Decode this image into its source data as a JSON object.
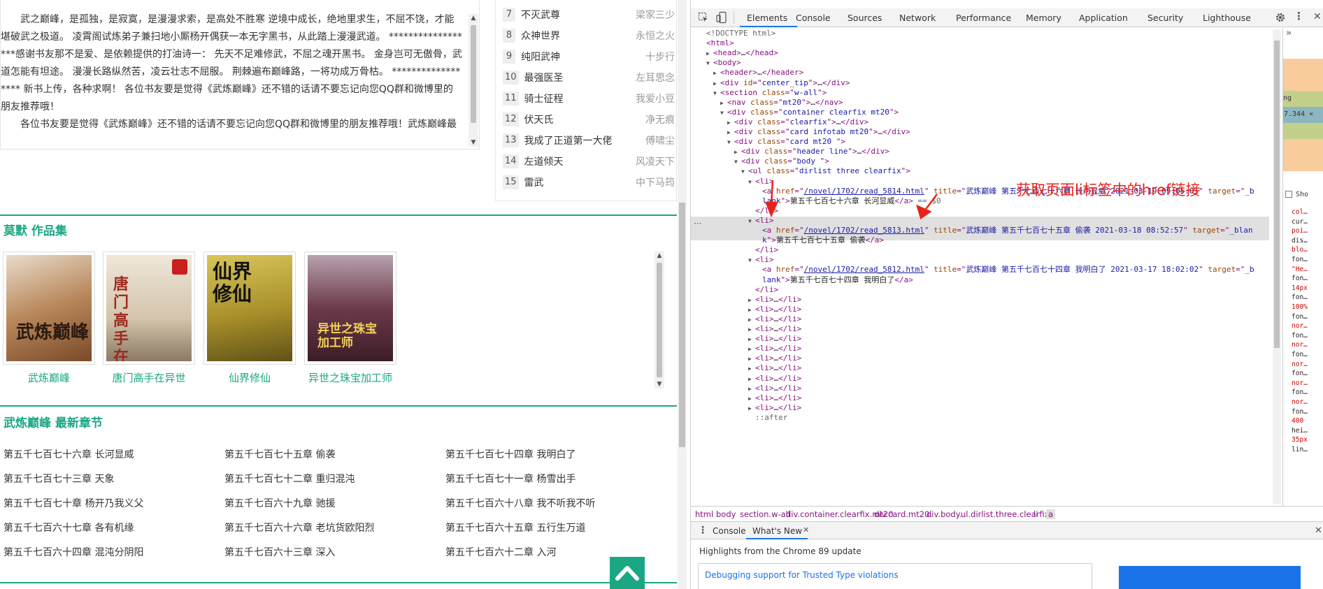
{
  "intro": {
    "paragraphs": [
      "武之巅峰，是孤独，是寂寞，是漫漫求索，是高处不胜寒 逆境中成长，绝地里求生，不屈不饶，才能堪破武之极道。 凌霄阁试炼弟子兼扫地小厮杨开偶获一本无字黑书，从此踏上漫漫武道。 ******************感谢书友那不是爱、是依赖提供的打油诗一： 先天不足难修武，不屈之魂开黑书。 金身岂可无傲骨，武道怎能有坦途。 漫漫长路纵然苦，凌云壮志不屈服。 荆棘遍布巅峰路，一将功成万骨枯。 ****************** 新书上传，各种求啊！ 各位书友要是觉得《武炼巅峰》还不错的话请不要忘记向您QQ群和微博里的朋友推荐哦！",
      "各位书友要是觉得《武炼巅峰》还不错的话请不要忘记向您QQ群和微博里的朋友推荐哦！武炼巅峰最"
    ]
  },
  "rank": [
    {
      "num": "7",
      "title": "不灭武尊",
      "author": "梁家三少"
    },
    {
      "num": "8",
      "title": "众神世界",
      "author": "永恒之火"
    },
    {
      "num": "9",
      "title": "纯阳武神",
      "author": "十步行"
    },
    {
      "num": "10",
      "title": "最强医圣",
      "author": "左耳思念"
    },
    {
      "num": "11",
      "title": "骑士征程",
      "author": "我爱小豆"
    },
    {
      "num": "12",
      "title": "伏天氏",
      "author": "净无痕"
    },
    {
      "num": "13",
      "title": "我成了正道第一大佬",
      "author": "傅啸尘"
    },
    {
      "num": "14",
      "title": "左道倾天",
      "author": "风凌天下"
    },
    {
      "num": "15",
      "title": "雷武",
      "author": "中下马筠"
    }
  ],
  "works": {
    "title": "莫默 作品集",
    "items": [
      {
        "name": "武炼巅峰",
        "cover_color": "#c9a87a"
      },
      {
        "name": "唐门高手在异世",
        "cover_color": "#d9cdbb"
      },
      {
        "name": "仙界修仙",
        "cover_color": "#b8a13a"
      },
      {
        "name": "异世之珠宝加工师",
        "cover_color": "#6a3344"
      }
    ],
    "cover_texts": [
      "武炼巅峰",
      "唐门高手在异世",
      "仙界修仙",
      "异世之珠宝加工师"
    ]
  },
  "latest": {
    "title": "武炼巅峰 最新章节",
    "chapters": [
      "第五千七百七十六章 长河显威",
      "第五千七百七十五章 偷袭",
      "第五千七百七十四章 我明白了",
      "第五千七百七十三章 天象",
      "第五千七百七十二章 重归混沌",
      "第五千七百七十一章 杨雪出手",
      "第五千七百七十章 杨开乃我义父",
      "第五千七百六十九章 驰援",
      "第五千七百六十八章 我不听我不听",
      "第五千七百六十七章 各有机缘",
      "第五千七百六十六章 老坑货欧阳烈",
      "第五千七百六十五章 五行生万道",
      "第五千七百六十四章 混沌分阴阳",
      "第五千七百六十三章 深入",
      "第五千七百六十二章 入河"
    ]
  },
  "devtools": {
    "tabs": [
      "Elements",
      "Console",
      "Sources",
      "Network",
      "Performance",
      "Memory",
      "Application",
      "Security",
      "Lighthouse"
    ],
    "active_tab": "Elements",
    "dom": [
      {
        "indent": 0,
        "tri": "",
        "parts": [
          [
            "cmt",
            "<!DOCTYPE html>"
          ]
        ]
      },
      {
        "indent": 0,
        "tri": "",
        "parts": [
          [
            "tag",
            "<html>"
          ]
        ]
      },
      {
        "indent": 1,
        "tri": "▶",
        "parts": [
          [
            "tag",
            "<head>"
          ],
          [
            "txt",
            "…"
          ],
          [
            "tag",
            "</head>"
          ]
        ]
      },
      {
        "indent": 1,
        "tri": "▼",
        "parts": [
          [
            "tag",
            "<body>"
          ]
        ]
      },
      {
        "indent": 2,
        "tri": "▶",
        "parts": [
          [
            "tag",
            "<header>"
          ],
          [
            "txt",
            "…"
          ],
          [
            "tag",
            "</header>"
          ]
        ]
      },
      {
        "indent": 2,
        "tri": "▶",
        "parts": [
          [
            "tag",
            "<div "
          ],
          [
            "attr",
            "id"
          ],
          [
            "tag",
            "=\""
          ],
          [
            "val",
            "center_tip"
          ],
          [
            "tag",
            "\">"
          ],
          [
            "txt",
            "…"
          ],
          [
            "tag",
            "</div>"
          ]
        ]
      },
      {
        "indent": 2,
        "tri": "▼",
        "parts": [
          [
            "tag",
            "<section "
          ],
          [
            "attr",
            "class"
          ],
          [
            "tag",
            "=\""
          ],
          [
            "val",
            "w-all"
          ],
          [
            "tag",
            "\">"
          ]
        ]
      },
      {
        "indent": 3,
        "tri": "▶",
        "parts": [
          [
            "tag",
            "<nav "
          ],
          [
            "attr",
            "class"
          ],
          [
            "tag",
            "=\""
          ],
          [
            "val",
            "mt20"
          ],
          [
            "tag",
            "\">"
          ],
          [
            "txt",
            "…"
          ],
          [
            "tag",
            "</nav>"
          ]
        ]
      },
      {
        "indent": 3,
        "tri": "▼",
        "parts": [
          [
            "tag",
            "<div "
          ],
          [
            "attr",
            "class"
          ],
          [
            "tag",
            "=\""
          ],
          [
            "val",
            "container clearfix mt20"
          ],
          [
            "tag",
            "\">"
          ]
        ]
      },
      {
        "indent": 4,
        "tri": "▶",
        "parts": [
          [
            "tag",
            "<div "
          ],
          [
            "attr",
            "class"
          ],
          [
            "tag",
            "=\""
          ],
          [
            "val",
            "clearfix"
          ],
          [
            "tag",
            "\">"
          ],
          [
            "txt",
            "…"
          ],
          [
            "tag",
            "</div>"
          ]
        ]
      },
      {
        "indent": 4,
        "tri": "▶",
        "parts": [
          [
            "tag",
            "<div "
          ],
          [
            "attr",
            "class"
          ],
          [
            "tag",
            "=\""
          ],
          [
            "val",
            "card infotab mt20"
          ],
          [
            "tag",
            "\">"
          ],
          [
            "txt",
            "…"
          ],
          [
            "tag",
            "</div>"
          ]
        ]
      },
      {
        "indent": 4,
        "tri": "▼",
        "parts": [
          [
            "tag",
            "<div "
          ],
          [
            "attr",
            "class"
          ],
          [
            "tag",
            "=\""
          ],
          [
            "val",
            "card mt20 "
          ],
          [
            "tag",
            "\">"
          ]
        ]
      },
      {
        "indent": 5,
        "tri": "▶",
        "parts": [
          [
            "tag",
            "<div "
          ],
          [
            "attr",
            "class"
          ],
          [
            "tag",
            "=\""
          ],
          [
            "val",
            "header line"
          ],
          [
            "tag",
            "\">"
          ],
          [
            "txt",
            "…"
          ],
          [
            "tag",
            "</div>"
          ]
        ]
      },
      {
        "indent": 5,
        "tri": "▼",
        "parts": [
          [
            "tag",
            "<div "
          ],
          [
            "attr",
            "class"
          ],
          [
            "tag",
            "=\""
          ],
          [
            "val",
            "body "
          ],
          [
            "tag",
            "\">"
          ]
        ]
      },
      {
        "indent": 6,
        "tri": "▼",
        "parts": [
          [
            "tag",
            "<ul "
          ],
          [
            "attr",
            "class"
          ],
          [
            "tag",
            "=\""
          ],
          [
            "val",
            "dirlist three clearfix"
          ],
          [
            "tag",
            "\">"
          ]
        ]
      },
      {
        "indent": 7,
        "tri": "▼",
        "parts": [
          [
            "tag",
            "<li>"
          ]
        ]
      },
      {
        "indent": 8,
        "tri": "",
        "parts": [
          [
            "tag",
            "<a "
          ],
          [
            "attr",
            "href"
          ],
          [
            "tag",
            "=\""
          ],
          [
            "link",
            "/novel/1702/read_5814.html"
          ],
          [
            "tag",
            "\" "
          ],
          [
            "attr",
            "title"
          ],
          [
            "tag",
            "=\""
          ],
          [
            "val",
            "武炼巅峰 第五千七百七十六章 长河显威 2021-03-19 09:05:01"
          ],
          [
            "tag",
            "\" "
          ],
          [
            "attr",
            "target"
          ],
          [
            "tag",
            "=\""
          ],
          [
            "val",
            "_b"
          ]
        ]
      },
      {
        "indent": 8,
        "tri": "",
        "parts": [
          [
            "val",
            "lank"
          ],
          [
            "tag",
            "\">"
          ],
          [
            "txt",
            "第五千七百七十六章 长河显威"
          ],
          [
            "tag",
            "</a>"
          ],
          [
            "cmt",
            " == $0"
          ]
        ]
      },
      {
        "indent": 7,
        "tri": "",
        "parts": [
          [
            "tag",
            "</li>"
          ]
        ]
      },
      {
        "indent": 7,
        "tri": "▼",
        "parts": [
          [
            "tag",
            "<li>"
          ]
        ]
      },
      {
        "indent": 8,
        "tri": "",
        "parts": [
          [
            "tag",
            "<a "
          ],
          [
            "attr",
            "href"
          ],
          [
            "tag",
            "=\""
          ],
          [
            "link",
            "/novel/1702/read_5813.html"
          ],
          [
            "tag",
            "\" "
          ],
          [
            "attr",
            "title"
          ],
          [
            "tag",
            "=\""
          ],
          [
            "val",
            "武炼巅峰 第五千七百七十五章 偷袭 2021-03-18 08:52:57"
          ],
          [
            "tag",
            "\" "
          ],
          [
            "attr",
            "target"
          ],
          [
            "tag",
            "=\""
          ],
          [
            "val",
            "_blan"
          ]
        ]
      },
      {
        "indent": 8,
        "tri": "",
        "parts": [
          [
            "val",
            "k"
          ],
          [
            "tag",
            "\">"
          ],
          [
            "txt",
            "第五千七百七十五章 偷袭"
          ],
          [
            "tag",
            "</a>"
          ]
        ]
      },
      {
        "indent": 7,
        "tri": "",
        "parts": [
          [
            "tag",
            "</li>"
          ]
        ]
      },
      {
        "indent": 7,
        "tri": "▼",
        "parts": [
          [
            "tag",
            "<li>"
          ]
        ]
      },
      {
        "indent": 8,
        "tri": "",
        "parts": [
          [
            "tag",
            "<a "
          ],
          [
            "attr",
            "href"
          ],
          [
            "tag",
            "=\""
          ],
          [
            "link",
            "/novel/1702/read_5812.html"
          ],
          [
            "tag",
            "\" "
          ],
          [
            "attr",
            "title"
          ],
          [
            "tag",
            "=\""
          ],
          [
            "val",
            "武炼巅峰 第五千七百七十四章 我明白了 2021-03-17 18:02:02"
          ],
          [
            "tag",
            "\" "
          ],
          [
            "attr",
            "target"
          ],
          [
            "tag",
            "=\""
          ],
          [
            "val",
            "_b"
          ]
        ]
      },
      {
        "indent": 8,
        "tri": "",
        "parts": [
          [
            "val",
            "lank"
          ],
          [
            "tag",
            "\">"
          ],
          [
            "txt",
            "第五千七百七十四章 我明白了"
          ],
          [
            "tag",
            "</a>"
          ]
        ]
      },
      {
        "indent": 7,
        "tri": "",
        "parts": [
          [
            "tag",
            "</li>"
          ]
        ]
      },
      {
        "indent": 7,
        "tri": "▶",
        "parts": [
          [
            "tag",
            "<li>"
          ],
          [
            "txt",
            "…"
          ],
          [
            "tag",
            "</li>"
          ]
        ]
      },
      {
        "indent": 7,
        "tri": "▶",
        "parts": [
          [
            "tag",
            "<li>"
          ],
          [
            "txt",
            "…"
          ],
          [
            "tag",
            "</li>"
          ]
        ]
      },
      {
        "indent": 7,
        "tri": "▶",
        "parts": [
          [
            "tag",
            "<li>"
          ],
          [
            "txt",
            "…"
          ],
          [
            "tag",
            "</li>"
          ]
        ]
      },
      {
        "indent": 7,
        "tri": "▶",
        "parts": [
          [
            "tag",
            "<li>"
          ],
          [
            "txt",
            "…"
          ],
          [
            "tag",
            "</li>"
          ]
        ]
      },
      {
        "indent": 7,
        "tri": "▶",
        "parts": [
          [
            "tag",
            "<li>"
          ],
          [
            "txt",
            "…"
          ],
          [
            "tag",
            "</li>"
          ]
        ]
      },
      {
        "indent": 7,
        "tri": "▶",
        "parts": [
          [
            "tag",
            "<li>"
          ],
          [
            "txt",
            "…"
          ],
          [
            "tag",
            "</li>"
          ]
        ]
      },
      {
        "indent": 7,
        "tri": "▶",
        "parts": [
          [
            "tag",
            "<li>"
          ],
          [
            "txt",
            "…"
          ],
          [
            "tag",
            "</li>"
          ]
        ]
      },
      {
        "indent": 7,
        "tri": "▶",
        "parts": [
          [
            "tag",
            "<li>"
          ],
          [
            "txt",
            "…"
          ],
          [
            "tag",
            "</li>"
          ]
        ]
      },
      {
        "indent": 7,
        "tri": "▶",
        "parts": [
          [
            "tag",
            "<li>"
          ],
          [
            "txt",
            "…"
          ],
          [
            "tag",
            "</li>"
          ]
        ]
      },
      {
        "indent": 7,
        "tri": "▶",
        "parts": [
          [
            "tag",
            "<li>"
          ],
          [
            "txt",
            "…"
          ],
          [
            "tag",
            "</li>"
          ]
        ]
      },
      {
        "indent": 7,
        "tri": "▶",
        "parts": [
          [
            "tag",
            "<li>"
          ],
          [
            "txt",
            "…"
          ],
          [
            "tag",
            "</li>"
          ]
        ]
      },
      {
        "indent": 7,
        "tri": "▶",
        "parts": [
          [
            "tag",
            "<li>"
          ],
          [
            "txt",
            "…"
          ],
          [
            "tag",
            "</li>"
          ]
        ]
      },
      {
        "indent": 7,
        "tri": "",
        "parts": [
          [
            "cmt",
            "::after"
          ]
        ]
      }
    ],
    "breadcrumb": [
      "html",
      "body",
      "section.w-all",
      "div.container.clearfix.mt20",
      "div.card.mt20.",
      "div.body.",
      "ul.dirlist.three.clearfix",
      "li",
      "a"
    ],
    "drawer_tabs": [
      "Console",
      "What's New"
    ],
    "drawer_highlight": "Highlights from the Chrome 89 update",
    "drawer_link": "Debugging support for Trusted Type violations",
    "styles_items": [
      "col…",
      "cur…",
      "poi…",
      "dis…",
      "blo…",
      "fon…",
      "\"He…",
      "fon…",
      "14px",
      "fon…",
      "100%",
      "fon…",
      "nor…",
      "fon…",
      "nor…",
      "fon…",
      "nor…",
      "fon…",
      "nor…",
      "fon…",
      "nor…",
      "fon…",
      "400",
      "hei…",
      "35px",
      "lin…"
    ],
    "styles_box_values": [
      "7.344 ×",
      "ng"
    ],
    "show_all": "Sho"
  },
  "annotation": "获取页面li标签中的href链接",
  "colors": {
    "accent": "#1ba784",
    "annotation": "#e8231a",
    "devtools_link": "#1a73e8"
  }
}
